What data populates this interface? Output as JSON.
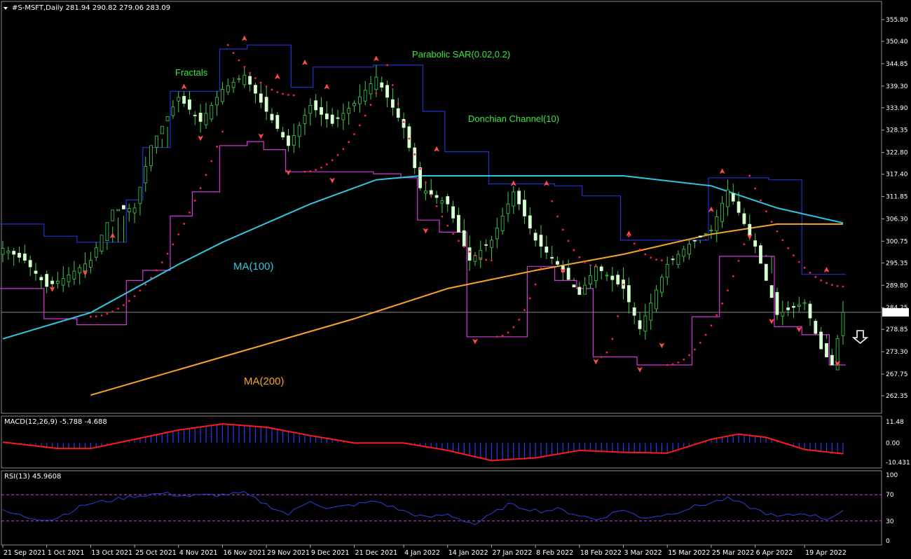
{
  "header": {
    "title": "#S-MSFT,Daily  281.94 290.82 279.06 283.09"
  },
  "colors": {
    "candle": "#d8ffd0",
    "ma100": "#2ec7e0",
    "ma200": "#f5a623",
    "donchian_upper": "#2233cc",
    "donchian_lower": "#d03ad8",
    "sar": "#ff2040",
    "fractal": "#ff4a4a",
    "macd_hist": "#2a3aff",
    "macd_signal": "#ff1a1a",
    "rsi": "#2f3fe0",
    "rsi_level": "#d040d0",
    "grid": "#777777"
  },
  "annotations": {
    "fractals": "Fractals",
    "sar": "Parabolic SAR(0.02,0.2)",
    "donchian": "Donchian Channel(10)",
    "ma100": "MA(100)",
    "ma200": "MA(200)"
  },
  "price_axis": {
    "ticks": [
      "355.80",
      "350.40",
      "344.85",
      "339.30",
      "333.90",
      "328.35",
      "322.80",
      "317.40",
      "311.85",
      "306.30",
      "300.75",
      "295.35",
      "289.80",
      "284.25",
      "278.85",
      "273.30",
      "267.75",
      "262.35"
    ],
    "current_price": "283.09",
    "ylim": [
      262.35,
      355.8
    ]
  },
  "x_axis": {
    "labels": [
      "21 Sep 2021",
      "1 Oct 2021",
      "13 Oct 2021",
      "25 Oct 2021",
      "4 Nov 2021",
      "16 Nov 2021",
      "29 Nov 2021",
      "9 Dec 2021",
      "21 Dec 2021",
      "4 Jan 2022",
      "14 Jan 2022",
      "27 Jan 2022",
      "8 Feb 2022",
      "18 Feb 2022",
      "3 Mar 2022",
      "15 Mar 2022",
      "25 Mar 2022",
      "6 Apr 2022",
      "19 Apr 2022"
    ]
  },
  "macd": {
    "label": "MACD(12,26,9) -5.788 -4.688",
    "ticks": [
      "11.48",
      "0.00",
      "-10.431"
    ]
  },
  "rsi": {
    "label": "RSI(13) 45.9608",
    "ticks": [
      "100",
      "70",
      "30",
      "0"
    ]
  },
  "chart_data": {
    "type": "candlestick",
    "symbol": "#S-MSFT",
    "timeframe": "Daily",
    "last_ohlc": {
      "open": 281.94,
      "high": 290.82,
      "low": 279.06,
      "close": 283.09
    },
    "anchor_closes": [
      [
        "2021-09-21",
        299.0
      ],
      [
        "2021-09-27",
        296.0
      ],
      [
        "2021-10-01",
        289.5
      ],
      [
        "2021-10-06",
        291.5
      ],
      [
        "2021-10-13",
        296.0
      ],
      [
        "2021-10-19",
        308.5
      ],
      [
        "2021-10-25",
        309.0
      ],
      [
        "2021-10-28",
        324.5
      ],
      [
        "2021-11-04",
        336.5
      ],
      [
        "2021-11-10",
        330.5
      ],
      [
        "2021-11-16",
        338.5
      ],
      [
        "2021-11-22",
        342.0
      ],
      [
        "2021-11-29",
        333.0
      ],
      [
        "2021-12-03",
        324.5
      ],
      [
        "2021-12-09",
        334.5
      ],
      [
        "2021-12-15",
        330.0
      ],
      [
        "2021-12-21",
        335.0
      ],
      [
        "2021-12-28",
        341.5
      ],
      [
        "2022-01-04",
        329.0
      ],
      [
        "2022-01-07",
        314.0
      ],
      [
        "2022-01-14",
        310.0
      ],
      [
        "2022-01-21",
        296.0
      ],
      [
        "2022-01-27",
        301.0
      ],
      [
        "2022-02-02",
        313.0
      ],
      [
        "2022-02-08",
        301.0
      ],
      [
        "2022-02-14",
        295.0
      ],
      [
        "2022-02-18",
        287.5
      ],
      [
        "2022-02-24",
        294.5
      ],
      [
        "2022-03-03",
        289.0
      ],
      [
        "2022-03-08",
        279.0
      ],
      [
        "2022-03-15",
        295.0
      ],
      [
        "2022-03-21",
        300.0
      ],
      [
        "2022-03-25",
        303.5
      ],
      [
        "2022-03-30",
        313.5
      ],
      [
        "2022-04-06",
        299.5
      ],
      [
        "2022-04-12",
        282.5
      ],
      [
        "2022-04-19",
        285.5
      ],
      [
        "2022-04-22",
        274.0
      ],
      [
        "2022-04-26",
        270.0
      ],
      [
        "2022-04-28",
        283.09
      ]
    ],
    "ma100_points": [
      [
        "2021-09-21",
        276.5
      ],
      [
        "2021-10-13",
        283.0
      ],
      [
        "2021-11-04",
        295.0
      ],
      [
        "2021-11-16",
        300.5
      ],
      [
        "2021-12-09",
        310.0
      ],
      [
        "2021-12-28",
        316.0
      ],
      [
        "2022-01-07",
        317.0
      ],
      [
        "2022-02-08",
        317.0
      ],
      [
        "2022-03-03",
        317.0
      ],
      [
        "2022-03-25",
        314.5
      ],
      [
        "2022-04-12",
        309.0
      ],
      [
        "2022-04-28",
        305.3
      ]
    ],
    "ma200_points": [
      [
        "2021-10-13",
        262.5
      ],
      [
        "2021-11-16",
        272.0
      ],
      [
        "2021-12-21",
        281.5
      ],
      [
        "2022-01-14",
        289.0
      ],
      [
        "2022-02-08",
        293.5
      ],
      [
        "2022-03-03",
        297.5
      ],
      [
        "2022-03-25",
        302.5
      ],
      [
        "2022-04-12",
        305.0
      ],
      [
        "2022-04-28",
        305.0
      ]
    ],
    "donchian_upper_points": [
      [
        "2021-09-21",
        305.0
      ],
      [
        "2021-09-28",
        305.0
      ],
      [
        "2021-10-01",
        302.0
      ],
      [
        "2021-10-11",
        300.5
      ],
      [
        "2021-10-22",
        311.0
      ],
      [
        "2021-10-27",
        324.0
      ],
      [
        "2021-11-03",
        338.0
      ],
      [
        "2021-11-16",
        348.5
      ],
      [
        "2021-11-23",
        349.5
      ],
      [
        "2021-12-01",
        349.5
      ],
      [
        "2021-12-06",
        339.0
      ],
      [
        "2021-12-10",
        344.0
      ],
      [
        "2021-12-28",
        344.5
      ],
      [
        "2022-01-05",
        344.5
      ],
      [
        "2022-01-10",
        333.0
      ],
      [
        "2022-01-14",
        323.0
      ],
      [
        "2022-01-21",
        323.0
      ],
      [
        "2022-01-27",
        315.0
      ],
      [
        "2022-02-03",
        315.0
      ],
      [
        "2022-02-14",
        314.5
      ],
      [
        "2022-02-22",
        312.0
      ],
      [
        "2022-03-03",
        301.0
      ],
      [
        "2022-03-14",
        301.0
      ],
      [
        "2022-03-22",
        301.0
      ],
      [
        "2022-03-25",
        316.5
      ],
      [
        "2022-04-01",
        316.5
      ],
      [
        "2022-04-11",
        316.0
      ],
      [
        "2022-04-19",
        292.5
      ],
      [
        "2022-04-28",
        292.5
      ]
    ],
    "donchian_lower_points": [
      [
        "2021-09-21",
        289.0
      ],
      [
        "2021-09-28",
        289.0
      ],
      [
        "2021-10-01",
        281.5
      ],
      [
        "2021-10-11",
        280.0
      ],
      [
        "2021-10-18",
        280.0
      ],
      [
        "2021-10-22",
        291.0
      ],
      [
        "2021-10-27",
        293.5
      ],
      [
        "2021-11-03",
        307.0
      ],
      [
        "2021-11-09",
        313.0
      ],
      [
        "2021-11-16",
        324.5
      ],
      [
        "2021-11-23",
        325.5
      ],
      [
        "2021-11-29",
        323.5
      ],
      [
        "2021-12-03",
        318.0
      ],
      [
        "2021-12-14",
        318.0
      ],
      [
        "2021-12-28",
        317.5
      ],
      [
        "2022-01-04",
        316.5
      ],
      [
        "2022-01-07",
        306.0
      ],
      [
        "2022-01-13",
        303.0
      ],
      [
        "2022-01-21",
        277.0
      ],
      [
        "2022-01-27",
        277.0
      ],
      [
        "2022-02-02",
        277.0
      ],
      [
        "2022-02-07",
        294.5
      ],
      [
        "2022-02-14",
        291.0
      ],
      [
        "2022-02-18",
        289.0
      ],
      [
        "2022-02-24",
        272.0
      ],
      [
        "2022-03-03",
        272.0
      ],
      [
        "2022-03-08",
        270.0
      ],
      [
        "2022-03-15",
        270.0
      ],
      [
        "2022-03-22",
        282.0
      ],
      [
        "2022-03-29",
        297.0
      ],
      [
        "2022-04-06",
        297.0
      ],
      [
        "2022-04-12",
        279.5
      ],
      [
        "2022-04-19",
        277.5
      ],
      [
        "2022-04-26",
        270.0
      ],
      [
        "2022-04-28",
        270.0
      ]
    ],
    "sar_segments": [
      {
        "from": "2021-10-13",
        "to": "2021-11-16",
        "start": 282.0,
        "end": 328.0
      },
      {
        "from": "2021-11-17",
        "to": "2021-12-06",
        "start": 349.5,
        "end": 337.0
      },
      {
        "from": "2021-12-08",
        "to": "2021-12-28",
        "start": 318.0,
        "end": 337.5
      },
      {
        "from": "2021-12-30",
        "to": "2022-01-27",
        "start": 344.5,
        "end": 296.0
      },
      {
        "from": "2022-01-28",
        "to": "2022-02-09",
        "start": 277.0,
        "end": 294.0
      },
      {
        "from": "2022-02-10",
        "to": "2022-02-24",
        "start": 315.0,
        "end": 294.5
      },
      {
        "from": "2022-02-25",
        "to": "2022-03-03",
        "start": 272.0,
        "end": 290.0
      },
      {
        "from": "2022-03-04",
        "to": "2022-03-14",
        "start": 302.0,
        "end": 296.0
      },
      {
        "from": "2022-03-15",
        "to": "2022-04-04",
        "start": 270.0,
        "end": 300.0
      },
      {
        "from": "2022-04-05",
        "to": "2022-04-28",
        "start": 317.0,
        "end": 289.5
      }
    ],
    "fractals_up": [
      [
        "2021-10-19",
        302.0
      ],
      [
        "2021-11-05",
        339.0
      ],
      [
        "2021-11-22",
        351.0
      ],
      [
        "2021-12-01",
        341.5
      ],
      [
        "2021-12-08",
        345.0
      ],
      [
        "2021-12-14",
        339.0
      ],
      [
        "2021-12-28",
        346.0
      ],
      [
        "2022-01-12",
        323.5
      ],
      [
        "2022-02-02",
        315.0
      ],
      [
        "2022-02-10",
        315.0
      ],
      [
        "2022-03-04",
        302.5
      ],
      [
        "2022-03-25",
        308.5
      ],
      [
        "2022-03-29",
        318.0
      ],
      [
        "2022-04-25",
        293.5
      ]
    ],
    "fractals_down": [
      [
        "2021-10-04",
        289.0
      ],
      [
        "2021-10-12",
        293.0
      ],
      [
        "2021-11-10",
        326.5
      ],
      [
        "2021-11-26",
        327.0
      ],
      [
        "2021-12-03",
        318.0
      ],
      [
        "2021-12-15",
        316.0
      ],
      [
        "2022-01-10",
        303.5
      ],
      [
        "2022-01-24",
        276.0
      ],
      [
        "2022-02-15",
        293.5
      ],
      [
        "2022-02-24",
        271.0
      ],
      [
        "2022-03-08",
        269.0
      ],
      [
        "2022-03-14",
        275.0
      ],
      [
        "2022-04-05",
        302.0
      ],
      [
        "2022-04-11",
        281.0
      ],
      [
        "2022-04-18",
        279.0
      ],
      [
        "2022-04-27",
        270.5
      ]
    ],
    "macd_points": [
      [
        "2021-09-21",
        0.5
      ],
      [
        "2021-10-05",
        -3.0
      ],
      [
        "2021-10-13",
        -3.0
      ],
      [
        "2021-10-25",
        2.0
      ],
      [
        "2021-11-04",
        7.0
      ],
      [
        "2021-11-16",
        10.3
      ],
      [
        "2021-11-29",
        8.5
      ],
      [
        "2021-12-09",
        4.0
      ],
      [
        "2021-12-21",
        0.0
      ],
      [
        "2022-01-04",
        0.0
      ],
      [
        "2022-01-14",
        -4.0
      ],
      [
        "2022-01-27",
        -9.5
      ],
      [
        "2022-02-08",
        -8.0
      ],
      [
        "2022-02-18",
        -4.0
      ],
      [
        "2022-03-03",
        -5.0
      ],
      [
        "2022-03-15",
        -5.5
      ],
      [
        "2022-03-25",
        2.0
      ],
      [
        "2022-04-01",
        4.8
      ],
      [
        "2022-04-08",
        3.0
      ],
      [
        "2022-04-19",
        -3.5
      ],
      [
        "2022-04-28",
        -5.8
      ]
    ],
    "macd_hist_scale": 1.0,
    "rsi_points": [
      [
        "2021-09-21",
        45
      ],
      [
        "2021-09-28",
        35
      ],
      [
        "2021-10-04",
        32
      ],
      [
        "2021-10-12",
        55
      ],
      [
        "2021-10-19",
        62
      ],
      [
        "2021-10-25",
        68
      ],
      [
        "2021-11-01",
        72
      ],
      [
        "2021-11-08",
        68
      ],
      [
        "2021-11-16",
        70
      ],
      [
        "2021-11-22",
        72
      ],
      [
        "2021-11-29",
        55
      ],
      [
        "2021-12-03",
        40
      ],
      [
        "2021-12-09",
        62
      ],
      [
        "2021-12-14",
        48
      ],
      [
        "2021-12-21",
        55
      ],
      [
        "2021-12-28",
        60
      ],
      [
        "2022-01-04",
        45
      ],
      [
        "2022-01-10",
        35
      ],
      [
        "2022-01-14",
        40
      ],
      [
        "2022-01-24",
        25
      ],
      [
        "2022-02-01",
        55
      ],
      [
        "2022-02-09",
        45
      ],
      [
        "2022-02-14",
        48
      ],
      [
        "2022-02-24",
        32
      ],
      [
        "2022-03-03",
        48
      ],
      [
        "2022-03-08",
        35
      ],
      [
        "2022-03-15",
        40
      ],
      [
        "2022-03-22",
        52
      ],
      [
        "2022-03-30",
        64
      ],
      [
        "2022-04-06",
        48
      ],
      [
        "2022-04-12",
        36
      ],
      [
        "2022-04-19",
        42
      ],
      [
        "2022-04-25",
        33
      ],
      [
        "2022-04-28",
        46
      ]
    ],
    "rsi_levels": [
      70,
      30
    ]
  }
}
